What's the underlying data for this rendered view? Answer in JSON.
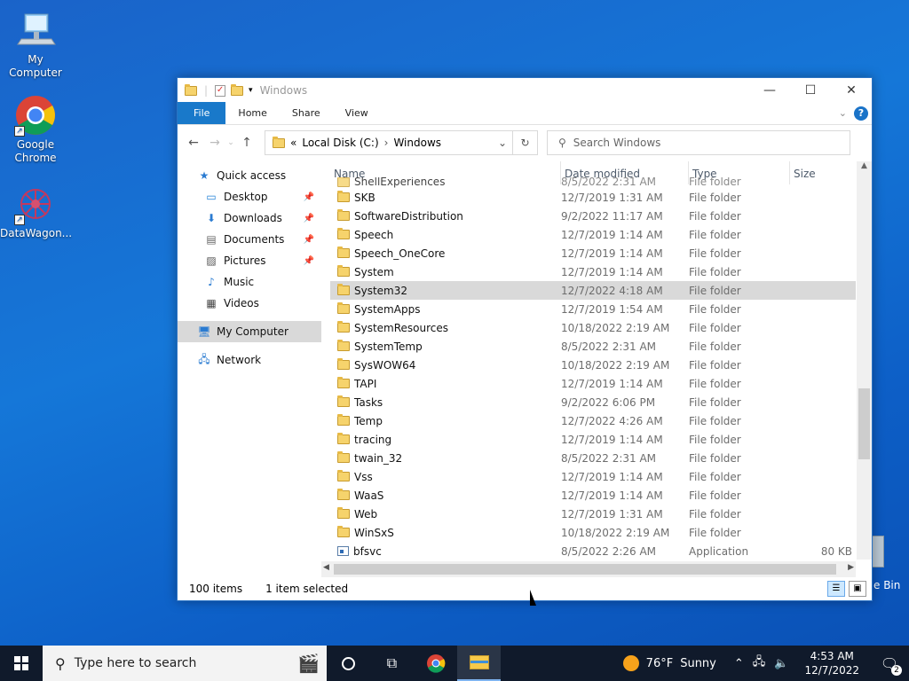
{
  "desktop": {
    "icons": [
      {
        "label": "My Computer"
      },
      {
        "label": "Google Chrome"
      },
      {
        "label": "DataWagon..."
      }
    ],
    "recycle_label": "e Bin"
  },
  "window": {
    "title": "Windows",
    "ribbon_tabs": [
      "File",
      "Home",
      "Share",
      "View"
    ],
    "address": {
      "chevron": "«",
      "crumbs": [
        "Local Disk (C:)",
        "Windows"
      ]
    },
    "search_placeholder": "Search Windows",
    "nav": [
      {
        "label": "Quick access",
        "icon": "star-icon"
      },
      {
        "label": "Desktop",
        "icon": "desktop-icon",
        "pinned": true
      },
      {
        "label": "Downloads",
        "icon": "download-icon",
        "pinned": true
      },
      {
        "label": "Documents",
        "icon": "document-icon",
        "pinned": true
      },
      {
        "label": "Pictures",
        "icon": "picture-icon",
        "pinned": true
      },
      {
        "label": "Music",
        "icon": "music-icon"
      },
      {
        "label": "Videos",
        "icon": "video-icon"
      },
      {
        "label": "My Computer",
        "icon": "computer-icon",
        "selected": true
      },
      {
        "label": "Network",
        "icon": "network-icon"
      }
    ],
    "columns": [
      "Name",
      "Date modified",
      "Type",
      "Size"
    ],
    "files": [
      {
        "name": "ShellExperiences",
        "date": "8/5/2022 2:31 AM",
        "type": "File folder",
        "size": ""
      },
      {
        "name": "SKB",
        "date": "12/7/2019 1:31 AM",
        "type": "File folder",
        "size": ""
      },
      {
        "name": "SoftwareDistribution",
        "date": "9/2/2022 11:17 AM",
        "type": "File folder",
        "size": ""
      },
      {
        "name": "Speech",
        "date": "12/7/2019 1:14 AM",
        "type": "File folder",
        "size": ""
      },
      {
        "name": "Speech_OneCore",
        "date": "12/7/2019 1:14 AM",
        "type": "File folder",
        "size": ""
      },
      {
        "name": "System",
        "date": "12/7/2019 1:14 AM",
        "type": "File folder",
        "size": ""
      },
      {
        "name": "System32",
        "date": "12/7/2022 4:18 AM",
        "type": "File folder",
        "size": "",
        "selected": true
      },
      {
        "name": "SystemApps",
        "date": "12/7/2019 1:54 AM",
        "type": "File folder",
        "size": ""
      },
      {
        "name": "SystemResources",
        "date": "10/18/2022 2:19 AM",
        "type": "File folder",
        "size": ""
      },
      {
        "name": "SystemTemp",
        "date": "8/5/2022 2:31 AM",
        "type": "File folder",
        "size": ""
      },
      {
        "name": "SysWOW64",
        "date": "10/18/2022 2:19 AM",
        "type": "File folder",
        "size": ""
      },
      {
        "name": "TAPI",
        "date": "12/7/2019 1:14 AM",
        "type": "File folder",
        "size": ""
      },
      {
        "name": "Tasks",
        "date": "9/2/2022 6:06 PM",
        "type": "File folder",
        "size": ""
      },
      {
        "name": "Temp",
        "date": "12/7/2022 4:26 AM",
        "type": "File folder",
        "size": ""
      },
      {
        "name": "tracing",
        "date": "12/7/2019 1:14 AM",
        "type": "File folder",
        "size": ""
      },
      {
        "name": "twain_32",
        "date": "8/5/2022 2:31 AM",
        "type": "File folder",
        "size": ""
      },
      {
        "name": "Vss",
        "date": "12/7/2019 1:14 AM",
        "type": "File folder",
        "size": ""
      },
      {
        "name": "WaaS",
        "date": "12/7/2019 1:14 AM",
        "type": "File folder",
        "size": ""
      },
      {
        "name": "Web",
        "date": "12/7/2019 1:31 AM",
        "type": "File folder",
        "size": ""
      },
      {
        "name": "WinSxS",
        "date": "10/18/2022 2:19 AM",
        "type": "File folder",
        "size": ""
      },
      {
        "name": "bfsvc",
        "date": "8/5/2022 2:26 AM",
        "type": "Application",
        "size": "80 KB",
        "app": true
      }
    ],
    "status": {
      "count": "100 items",
      "selected": "1 item selected"
    }
  },
  "taskbar": {
    "search_placeholder": "Type here to search",
    "weather": {
      "temp": "76°F",
      "cond": "Sunny"
    },
    "time": "4:53 AM",
    "date": "12/7/2022",
    "notifications": "2"
  }
}
